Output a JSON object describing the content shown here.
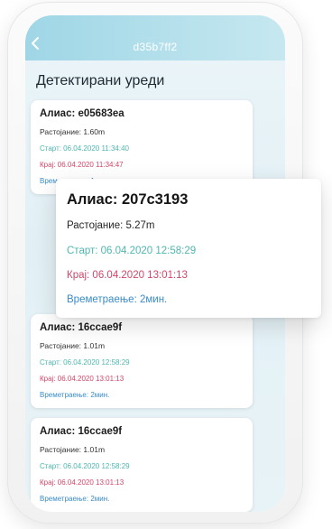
{
  "header": {
    "back_icon": "chevron-left-icon",
    "device_id": "d35b7ff2"
  },
  "page": {
    "title": "Детектирани уреди"
  },
  "cards": [
    {
      "alias": "Алиас: e05683ea",
      "distance": "Растојание: 1.60m",
      "start": "Старт: 06.04.2020 11:34:40",
      "end": "Крај: 06.04.2020 11:34:47",
      "duration": "Времетраење: 1мин."
    },
    {
      "alias": "Алиас: 16ccae9f",
      "distance": "Растојание: 1.01m",
      "start": "Старт: 06.04.2020 12:58:29",
      "end": "Крај: 06.04.2020 13:01:13",
      "duration": "Времетраење: 2мин."
    },
    {
      "alias": "Алиас: 16ccae9f",
      "distance": "Растојание: 1.01m",
      "start": "Старт: 06.04.2020 12:58:29",
      "end": "Крај: 06.04.2020 13:01:13",
      "duration": "Времетраење: 2мин."
    }
  ],
  "popup": {
    "alias": "Алиас: 207c3193",
    "distance": "Растојание: 5.27m",
    "start": "Старт: 06.04.2020 12:58:29",
    "end": "Крај: 06.04.2020 13:01:13",
    "duration": "Времетраење: 2мин."
  },
  "colors": {
    "header_gradient_start": "#9fd6e6",
    "start_text": "#4fb6ae",
    "end_text": "#d2466a",
    "duration_text": "#3a8cc6"
  }
}
